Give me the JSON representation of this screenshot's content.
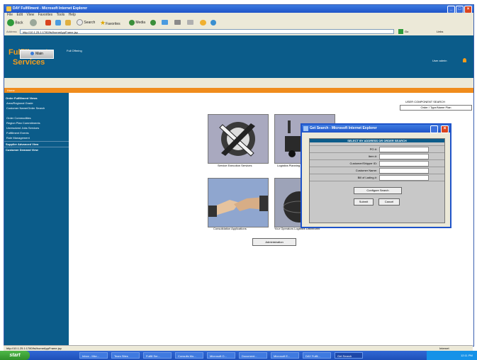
{
  "browser": {
    "title": "DAY Fulfillment - Microsoft Internet Explorer",
    "menu": [
      "File",
      "Edit",
      "View",
      "Favorites",
      "Tools",
      "Help"
    ],
    "toolbar": {
      "back": "Back",
      "search": "Search",
      "favorites": "Favorites",
      "media": "Media",
      "go": "Go",
      "links": "Links"
    },
    "address_label": "Address",
    "address": "http://10.1.25.1:1780/fsi/homeAppFrame.jsp",
    "status_text": "http://10.1.25.1:1780/fsi/homeAppFrame.jsp",
    "zone": "Internet"
  },
  "app": {
    "brand_line1": "Fulfillment",
    "brand_line2": "Services",
    "user_link": "User admin",
    "main_button": "Main",
    "offering_link": "Full Offering",
    "home_link": "Home"
  },
  "sidebar": {
    "section1": "Order Fulfillment Views",
    "items": [
      "Area/Regional Grade",
      "Customer Name/Order Search",
      "Order Commodities",
      "Region Plan Commitments",
      "Unresolved Jobs Services",
      "Fulfillment Events",
      "Role Management"
    ],
    "section2": "Supplier Advanced View",
    "section3": "Customer Demand View"
  },
  "content": {
    "search_label": "USER COMPONENT SEARCH",
    "order_box": "Order / Type/Name Plan",
    "tiles": [
      {
        "caption": "Service Execution Services"
      },
      {
        "caption": "Logistics Planning"
      },
      {
        "caption": "Consolidation Applications"
      },
      {
        "caption": "Your Operators Logistics Dashboard"
      }
    ],
    "admin_button": "Administration"
  },
  "dialog": {
    "title": "Get Search - Microsoft Internet Explorer",
    "header": "SELECT BY ADDRESS OR ORDER SEARCH",
    "fields": [
      {
        "label": "PO #:"
      },
      {
        "label": "Item #:"
      },
      {
        "label": "Customer/Shipper ID:"
      },
      {
        "label": "Customer Name:"
      },
      {
        "label": "Bill of Lading #:"
      }
    ],
    "configure_button": "Configure Search",
    "submit_button": "Submit",
    "cancel_button": "Cancel"
  },
  "taskbar": {
    "start": "start",
    "tasks": [
      "Inbox - Micr...",
      "Team Sites",
      "Fulfill Ser...",
      "Consults Mo...",
      "Microsoft O...",
      "Document...",
      "Microsoft E...",
      "DAY Fulfil...",
      "Get Search"
    ],
    "clock": "12:11 PM"
  }
}
